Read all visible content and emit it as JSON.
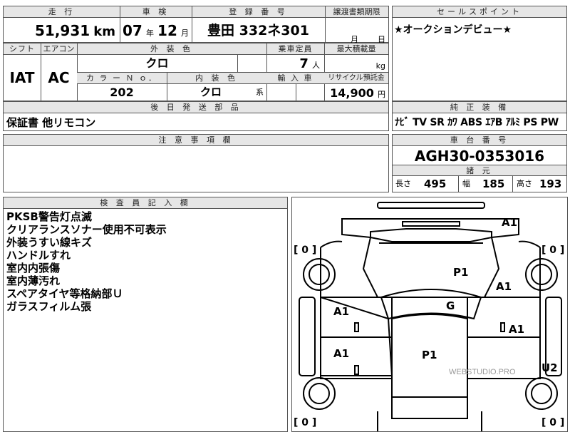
{
  "headers": {
    "mileage": "走 行",
    "inspection": "車 検",
    "registration": "登 録 番 号",
    "transfer": "譲渡書類期限",
    "sales_point": "セールスポイント",
    "shift": "シフト",
    "aircon": "エアコン",
    "exterior_color": "外 装 色",
    "capacity": "乗車定員",
    "max_load": "最大積載量",
    "color_no": "カ ラ ー Ｎ ｏ．",
    "interior_color": "内 装 色",
    "import": "輸 入 車",
    "recycle": "リサイクル預託金",
    "later_parts": "後 日 発 送 部 品",
    "equipment": "純 正 装 備",
    "caution": "注 意 事 項 欄",
    "chassis": "車 台 番 号",
    "dimensions": "諸 元",
    "inspector": "検 査 員 記 入 欄"
  },
  "vehicle": {
    "mileage": "51,931",
    "mileage_unit": "km",
    "inspection_year": "07",
    "year_unit": "年",
    "inspection_month": "12",
    "month_unit": "月",
    "registration": "豊田 332ネ301",
    "transfer_month_unit": "月",
    "transfer_day_unit": "日",
    "sales_point": "★オークションデビュー★",
    "shift": "IAT",
    "aircon": "AC",
    "exterior_color": "クロ",
    "capacity": "7",
    "capacity_unit": "人",
    "max_load_unit": "kg",
    "color_no": "202",
    "interior_color": "クロ",
    "interior_suffix": "系",
    "recycle_fee": "14,900",
    "recycle_unit": "円",
    "later_parts": "保証書 他リモコン",
    "equipment": "ﾅﾋﾞ TV SR ｶﾜ ABS ｴｱB ｱﾙﾐ PS PW",
    "chassis": "AGH30-0353016",
    "length_label": "長さ",
    "length": "495",
    "width_label": "幅",
    "width": "185",
    "height_label": "高さ",
    "height": "193"
  },
  "inspector_notes": [
    "PKSB警告灯点滅",
    "クリアランスソナー使用不可表示",
    "外装うすい線キズ",
    "ハンドルすれ",
    "室内内張傷",
    "室内薄汚れ",
    "スペアタイヤ等格納部Ｕ",
    "ガラスフィルム張"
  ],
  "diagram": {
    "tire_left_top": "[ 0 ]",
    "tire_right_top": "[ 0 ]",
    "tire_left_bottom": "[ 0 ]",
    "tire_right_bottom": "[ 0 ]",
    "marks": {
      "a1_top": "A1",
      "p1_hood": "P1",
      "a1_right_fender": "A1",
      "g_windshield": "G",
      "a1_left_front_door": "A1",
      "a1_right_front_door": "A1",
      "a1_left_rear_door": "A1",
      "p1_roof": "P1",
      "u2_right_rear": "U2"
    },
    "watermark": "WEBSTUDIO.PRO"
  }
}
